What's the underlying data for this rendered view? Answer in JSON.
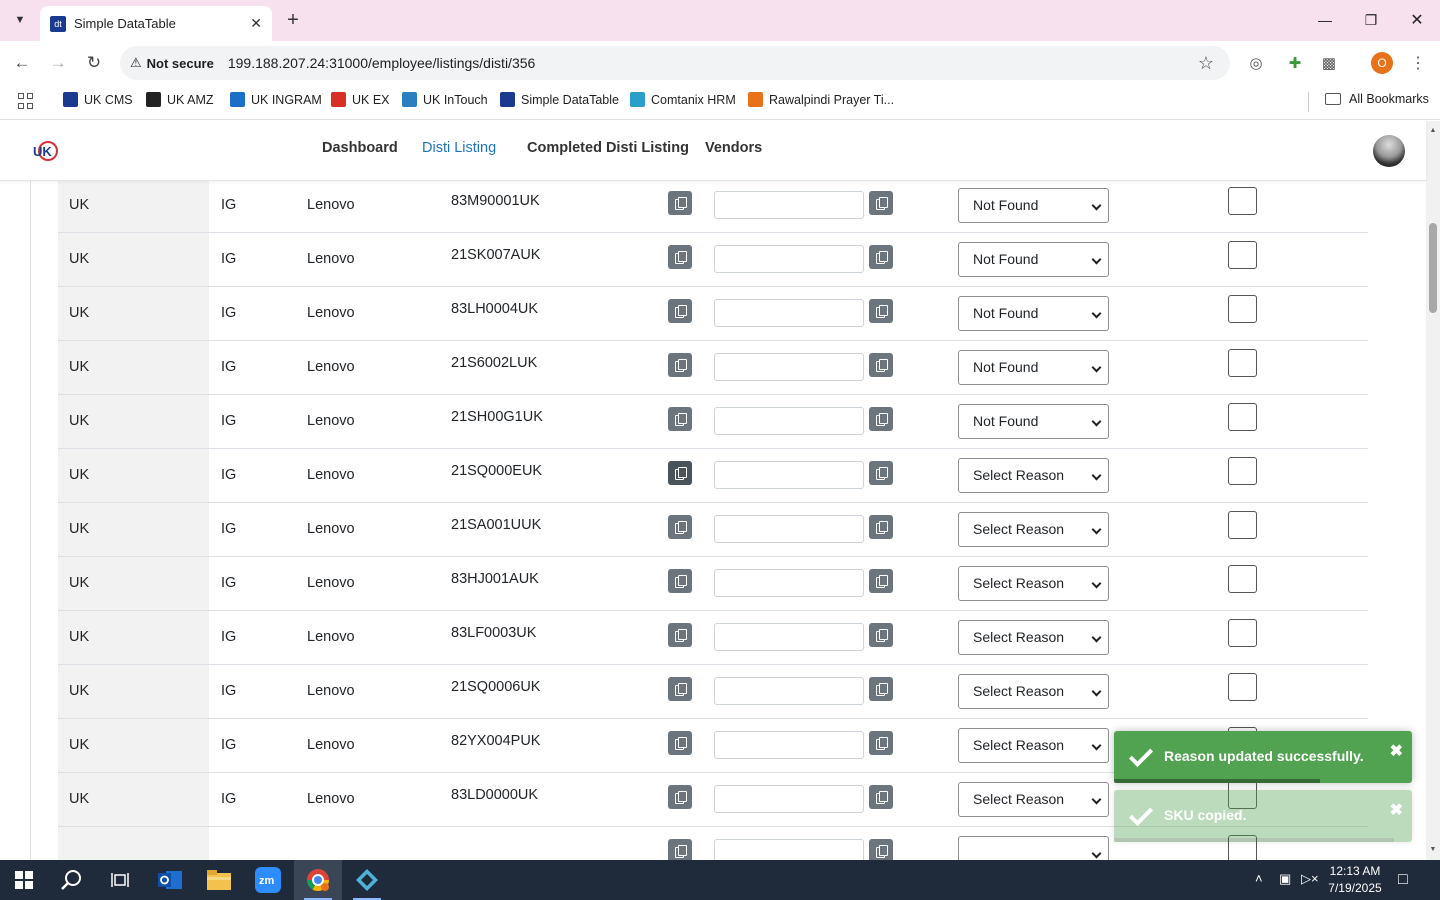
{
  "browser": {
    "tab_title": "Simple DataTable",
    "security_label": "Not secure",
    "url": "199.188.207.24:31000/employee/listings/disti/356",
    "profile_initial": "O",
    "bookmarks": [
      {
        "label": "UK CMS",
        "color": "#1a3a8f"
      },
      {
        "label": "UK AMZ",
        "color": "#222222"
      },
      {
        "label": "UK INGRAM",
        "color": "#1a6fc7"
      },
      {
        "label": "UK EX",
        "color": "#d93025"
      },
      {
        "label": "UK InTouch",
        "color": "#2a7fc0"
      },
      {
        "label": "Simple DataTable",
        "color": "#1a3a8f"
      },
      {
        "label": "Comtanix HRM",
        "color": "#2a9fc9"
      },
      {
        "label": "Rawalpindi Prayer Ti...",
        "color": "#e8711a"
      }
    ],
    "all_bookmarks_label": "All Bookmarks"
  },
  "nav": {
    "links": [
      "Dashboard",
      "Disti Listing",
      "Completed Disti Listing",
      "Vendors"
    ],
    "active": "Disti Listing"
  },
  "table": {
    "rows": [
      {
        "country": "UK",
        "disti": "IG",
        "brand": "Lenovo",
        "sku": "",
        "reason": "Not Found"
      },
      {
        "country": "UK",
        "disti": "IG",
        "brand": "Lenovo",
        "sku": "83M90001UK",
        "reason": "Not Found"
      },
      {
        "country": "UK",
        "disti": "IG",
        "brand": "Lenovo",
        "sku": "21SK007AUK",
        "reason": "Not Found"
      },
      {
        "country": "UK",
        "disti": "IG",
        "brand": "Lenovo",
        "sku": "83LH0004UK",
        "reason": "Not Found"
      },
      {
        "country": "UK",
        "disti": "IG",
        "brand": "Lenovo",
        "sku": "21S6002LUK",
        "reason": "Not Found"
      },
      {
        "country": "UK",
        "disti": "IG",
        "brand": "Lenovo",
        "sku": "21SH00G1UK",
        "reason": "Not Found"
      },
      {
        "country": "UK",
        "disti": "IG",
        "brand": "Lenovo",
        "sku": "21SQ000EUK",
        "reason": "Select Reason"
      },
      {
        "country": "UK",
        "disti": "IG",
        "brand": "Lenovo",
        "sku": "21SA001UUK",
        "reason": "Select Reason"
      },
      {
        "country": "UK",
        "disti": "IG",
        "brand": "Lenovo",
        "sku": "83HJ001AUK",
        "reason": "Select Reason"
      },
      {
        "country": "UK",
        "disti": "IG",
        "brand": "Lenovo",
        "sku": "83LF0003UK",
        "reason": "Select Reason"
      },
      {
        "country": "UK",
        "disti": "IG",
        "brand": "Lenovo",
        "sku": "21SQ0006UK",
        "reason": "Select Reason"
      },
      {
        "country": "UK",
        "disti": "IG",
        "brand": "Lenovo",
        "sku": "82YX004PUK",
        "reason": "Select Reason"
      },
      {
        "country": "UK",
        "disti": "IG",
        "brand": "Lenovo",
        "sku": "83LD0000UK",
        "reason": "Select Reason"
      },
      {
        "country": "",
        "disti": "",
        "brand": "",
        "sku": "",
        "reason": ""
      }
    ]
  },
  "toasts": [
    {
      "message": "Reason updated successfully.",
      "progress": 0.69
    },
    {
      "message": "SKU copied.",
      "progress": 0.94
    }
  ],
  "taskbar": {
    "time": "12:13 AM",
    "date": "7/19/2025"
  }
}
